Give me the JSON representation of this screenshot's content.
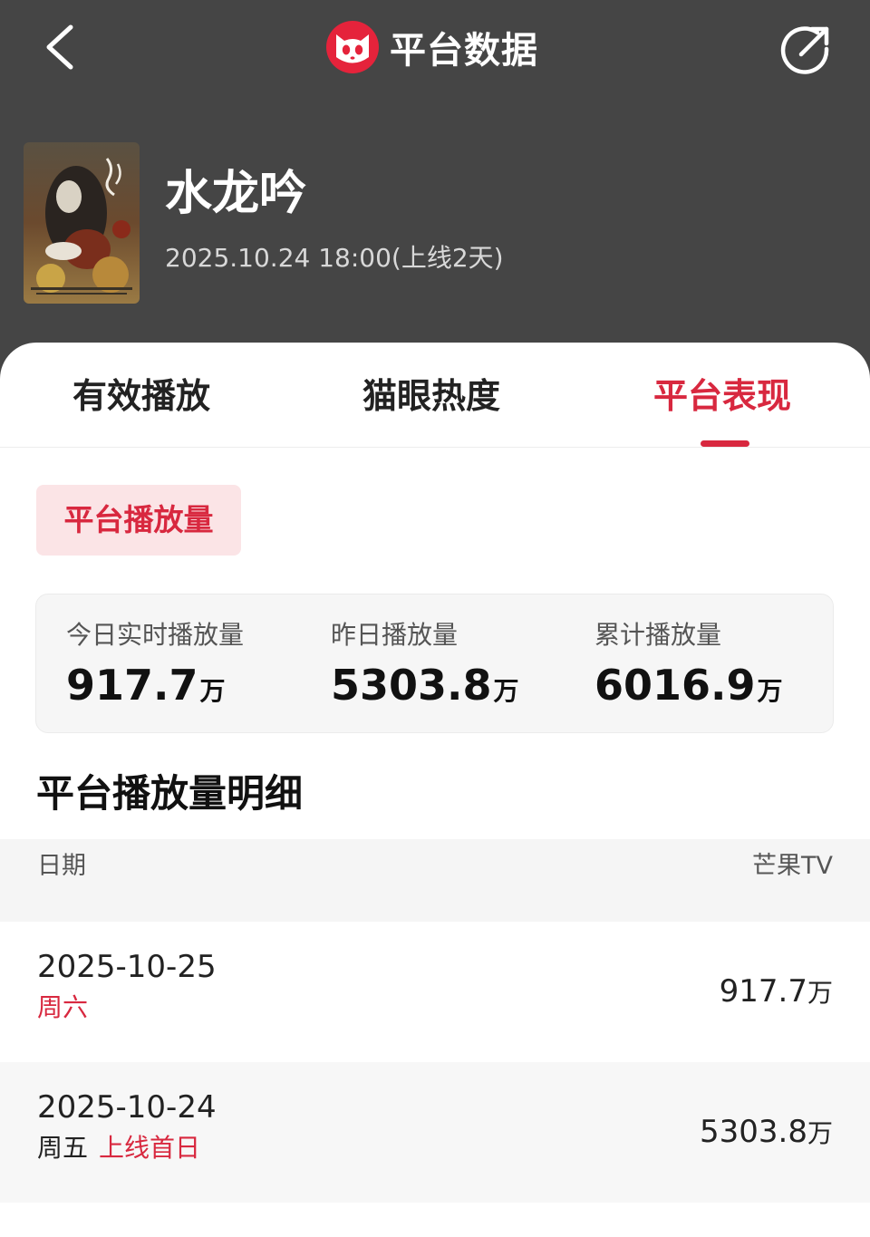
{
  "nav": {
    "title": "平台数据",
    "logo_icon": "maoyan-cat-logo",
    "back_icon": "back-arrow-icon",
    "share_icon": "share-icon"
  },
  "show": {
    "title": "水龙吟",
    "release_info": "2025.10.24 18:00(上线2天)"
  },
  "tabs": [
    {
      "label": "有效播放",
      "active": false
    },
    {
      "label": "猫眼热度",
      "active": false
    },
    {
      "label": "平台表现",
      "active": true
    }
  ],
  "chip_label": "平台播放量",
  "stats": [
    {
      "label": "今日实时播放量",
      "value": "917.7",
      "unit": "万"
    },
    {
      "label": "昨日播放量",
      "value": "5303.8",
      "unit": "万"
    },
    {
      "label": "累计播放量",
      "value": "6016.9",
      "unit": "万"
    }
  ],
  "detail_title": "平台播放量明细",
  "table": {
    "col_date": "日期",
    "col_platform": "芒果TV",
    "rows": [
      {
        "date": "2025-10-25",
        "weekday": "周六",
        "tag": "",
        "value": "917.7",
        "unit": "万"
      },
      {
        "date": "2025-10-24",
        "weekday": "周五",
        "tag": "上线首日",
        "value": "5303.8",
        "unit": "万"
      }
    ]
  },
  "colors": {
    "accent": "#d8283f",
    "header_bg": "#454545",
    "chip_bg": "#fbe4e6"
  }
}
